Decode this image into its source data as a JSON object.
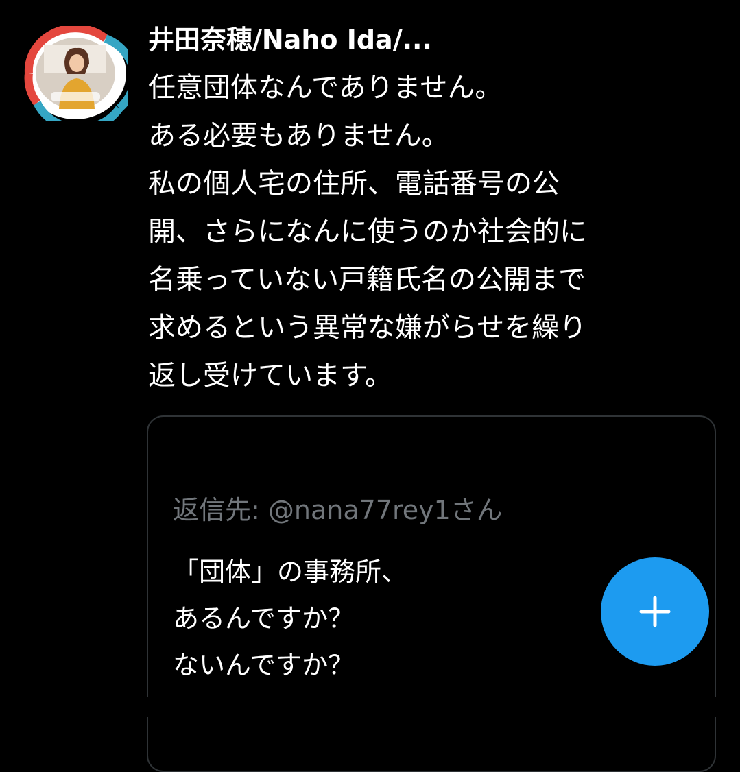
{
  "tweet": {
    "author_name": "井田奈穂/Naho Ida/...",
    "avatar_icon": "profile-photo-icon",
    "lines": [
      "任意団体なんでありません。",
      "ある必要もありません。",
      "私の個人宅の住所、電話番号の公",
      "開、さらになんに使うのか社会的に",
      "名乗っていない戸籍氏名の公開まで",
      "求めるという異常な嫌がらせを繰り",
      "返し受けています。"
    ]
  },
  "quoted_tweet": {
    "reply_to": "返信先: @nana77rey1さん",
    "lines": [
      "「団体」の事務所、",
      "あるんですか？",
      "ないんですか？"
    ]
  },
  "compose_button": {
    "icon": "plus-icon",
    "color": "#1d9bf0"
  },
  "colors": {
    "background": "#000000",
    "text_primary": "#ffffff",
    "text_secondary": "#71767b",
    "accent": "#1d9bf0",
    "border": "#2f3336"
  }
}
